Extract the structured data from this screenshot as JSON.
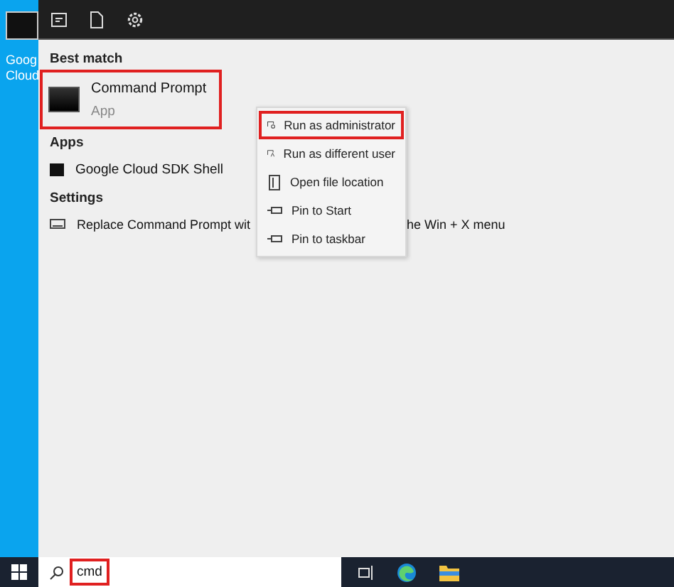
{
  "desktop_icon": {
    "label_lines": [
      "Goog",
      "Cloud"
    ]
  },
  "start_menu": {
    "sections": [
      {
        "heading": "Best match",
        "items": [
          {
            "kind": "best",
            "title": "Command Prompt",
            "subtitle": "App",
            "highlighted": true
          }
        ]
      },
      {
        "heading": "Apps",
        "items": [
          {
            "kind": "app",
            "title": "Google Cloud SDK Shell",
            "highlighted": false
          }
        ]
      },
      {
        "heading": "Settings",
        "items": [
          {
            "kind": "setting",
            "title": "Replace Command Prompt wit",
            "title_after": "he Win + X menu",
            "highlighted": false
          }
        ]
      }
    ]
  },
  "context_menu": {
    "items": [
      {
        "kind": "admin",
        "label": "Run as administrator",
        "highlighted": true
      },
      {
        "kind": "user",
        "label": "Run as different user",
        "highlighted": false
      },
      {
        "kind": "folder",
        "label": "Open file location",
        "highlighted": false
      },
      {
        "kind": "pin",
        "label": "Pin to Start",
        "highlighted": false
      },
      {
        "kind": "pin",
        "label": "Pin to taskbar",
        "highlighted": false
      }
    ]
  },
  "taskbar": {
    "search": {
      "value": "cmd",
      "highlighted": true
    }
  }
}
